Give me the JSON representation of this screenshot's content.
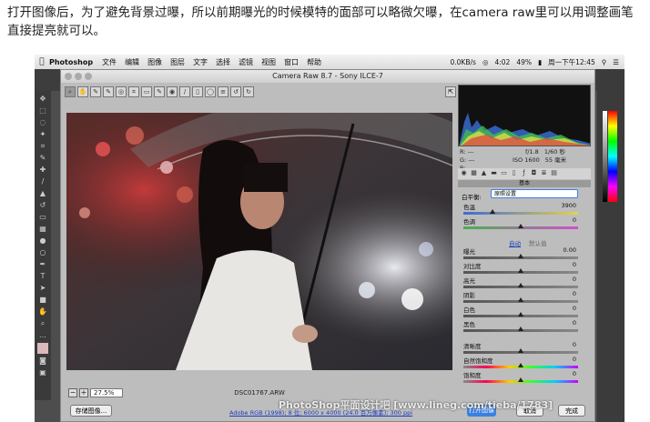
{
  "intro": "打开图像后，为了避免背景过曝，所以前期曝光的时候模特的面部可以略微欠曝，在camera raw里可以用调整画笔直接提亮就可以。",
  "menubar": {
    "app": "Photoshop",
    "items": [
      "文件",
      "编辑",
      "图像",
      "图层",
      "文字",
      "选择",
      "滤镜",
      "视图",
      "窗口",
      "帮助"
    ],
    "status": {
      "net": "0.0KB/s",
      "time": "4:02",
      "battery": "49%",
      "date": "周一下午12:45"
    }
  },
  "dialog": {
    "title": "Camera Raw 8.7  -  Sony ILCE-7",
    "zoom": "27.5%",
    "filename": "DSC01767.ARW",
    "save_label": "存储图像...",
    "workflow": "Adobe RGB (1998); 8 位; 6000 x 4000 (24.0 百万像素); 300 ppi",
    "open_label": "打开图像",
    "cancel_label": "取消",
    "done_label": "完成"
  },
  "histogram": {
    "r": "R:",
    "g": "G:",
    "b": "B:",
    "dash": "---",
    "aperture": "f/1.8",
    "shutter": "1/60 秒",
    "iso": "ISO 1600",
    "focal": "55 毫米"
  },
  "panel": {
    "section": "基本",
    "wb_label": "白平衡:",
    "wb_value": "原照设置",
    "auto": "自动",
    "default": "默认值",
    "sliders": [
      {
        "label": "色温",
        "value": "3900",
        "pos": 0.25
      },
      {
        "label": "色调",
        "value": "0",
        "pos": 0.5
      },
      {
        "label": "曝光",
        "value": "0.00",
        "pos": 0.5
      },
      {
        "label": "对比度",
        "value": "0",
        "pos": 0.5
      },
      {
        "label": "高光",
        "value": "0",
        "pos": 0.5
      },
      {
        "label": "阴影",
        "value": "0",
        "pos": 0.5
      },
      {
        "label": "白色",
        "value": "0",
        "pos": 0.5
      },
      {
        "label": "黑色",
        "value": "0",
        "pos": 0.5
      },
      {
        "label": "清晰度",
        "value": "0",
        "pos": 0.5
      },
      {
        "label": "自然饱和度",
        "value": "0",
        "pos": 0.5
      },
      {
        "label": "饱和度",
        "value": "0",
        "pos": 0.5
      }
    ]
  },
  "watermark": "PhotoShop平面设计吧 [www.lineg.com/tieba/1783]"
}
